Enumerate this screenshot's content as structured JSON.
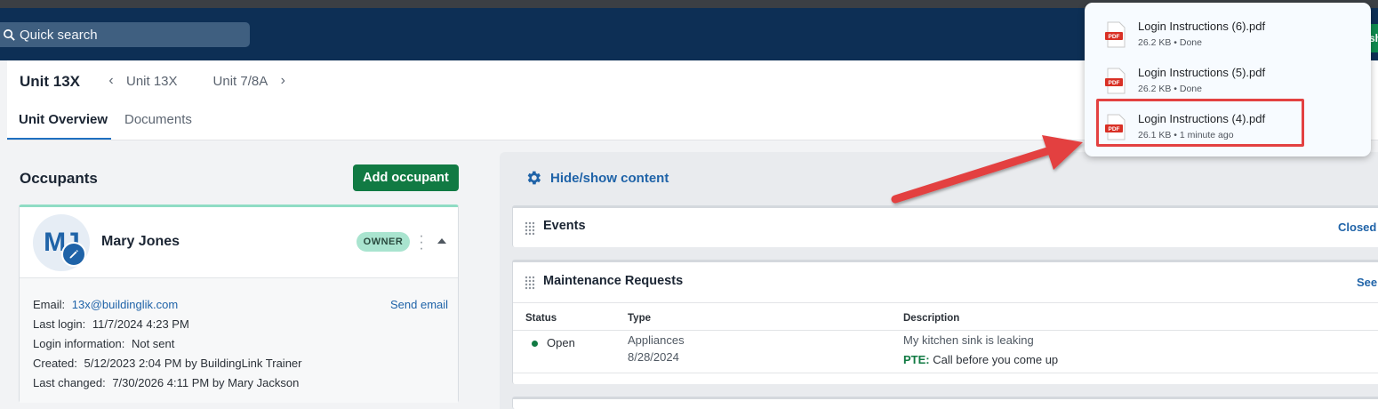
{
  "topbar": {
    "search_placeholder": "Quick search",
    "edge_button_label": "sh"
  },
  "unit_header": {
    "title": "Unit 13X",
    "nav_units": [
      "Unit 13X",
      "Unit 7/8A"
    ],
    "tabs": [
      {
        "label": "Unit Overview",
        "active": true
      },
      {
        "label": "Documents",
        "active": false
      }
    ]
  },
  "occupants": {
    "title": "Occupants",
    "add_button": "Add occupant",
    "occupant": {
      "initials": "MJ",
      "name": "Mary Jones",
      "badge": "OWNER",
      "email_label": "Email:",
      "email": "13x@buildinglik.com",
      "send_email": "Send email",
      "last_login_label": "Last login:",
      "last_login": "11/7/2024 4:23 PM",
      "login_info_label": "Login information:",
      "login_info": "Not sent",
      "created_label": "Created:",
      "created": "5/12/2023 2:04 PM by BuildingLink Trainer",
      "last_changed_label": "Last changed:",
      "last_changed": "7/30/2026 4:11 PM by Mary Jackson"
    }
  },
  "content": {
    "hide_show": "Hide/show content",
    "events": {
      "title": "Events",
      "link": "Closed e"
    },
    "maintenance": {
      "title": "Maintenance Requests",
      "link": "See",
      "columns": [
        "Status",
        "Type",
        "Description"
      ],
      "rows": [
        {
          "status": "Open",
          "type": "Appliances",
          "date": "8/28/2024",
          "description": "My kitchen sink is leaking",
          "pte_label": "PTE:",
          "pte_note": "Call before you come up"
        }
      ]
    }
  },
  "downloads": {
    "items": [
      {
        "name": "Login Instructions (6).pdf",
        "meta": "26.2 KB • Done"
      },
      {
        "name": "Login Instructions (5).pdf",
        "meta": "26.2 KB • Done"
      },
      {
        "name": "Login Instructions (4).pdf",
        "meta": "26.1 KB • 1 minute ago"
      }
    ],
    "highlighted_index": 2
  },
  "colors": {
    "topbar": "#0d2f55",
    "accent_green": "#117a43",
    "link_blue": "#1f63a8",
    "annotation_red": "#e34141"
  }
}
